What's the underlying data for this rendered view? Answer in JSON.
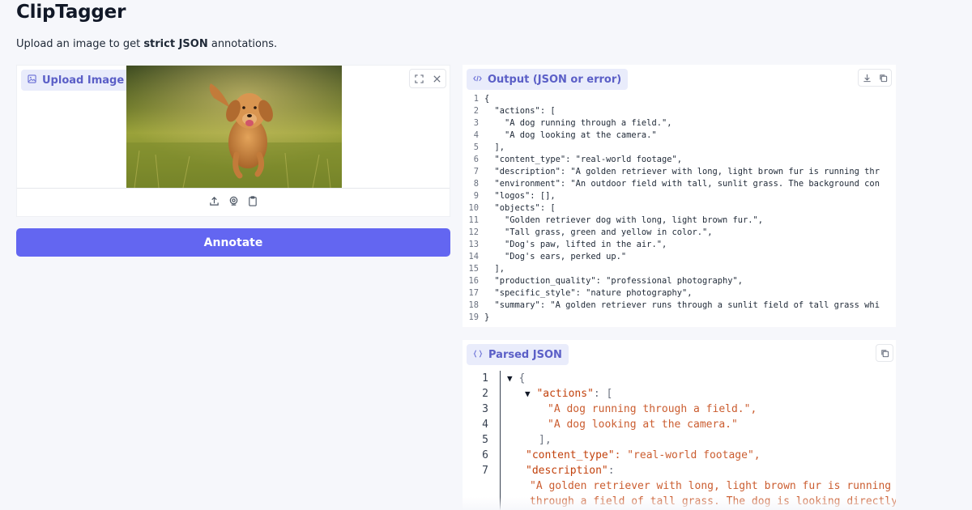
{
  "app": {
    "title": "ClipTagger",
    "subtitle_prefix": "Upload an image to get ",
    "subtitle_bold": "strict JSON",
    "subtitle_suffix": " annotations."
  },
  "upload": {
    "label": "Upload Image",
    "icon": "image-icon",
    "tools": [
      "fullscreen-icon",
      "close-icon"
    ],
    "actions": [
      "upload-icon",
      "webcam-icon",
      "clipboard-icon"
    ]
  },
  "annotate_button": "Annotate",
  "output": {
    "label": "Output (JSON or error)",
    "icon": "code-icon",
    "tools": [
      "download-icon",
      "copy-icon"
    ],
    "lines": [
      {
        "n": "1",
        "t": "{"
      },
      {
        "n": "2",
        "t": "  \"actions\": ["
      },
      {
        "n": "3",
        "t": "    \"A dog running through a field.\","
      },
      {
        "n": "4",
        "t": "    \"A dog looking at the camera.\""
      },
      {
        "n": "5",
        "t": "  ],"
      },
      {
        "n": "6",
        "t": "  \"content_type\": \"real-world footage\","
      },
      {
        "n": "7",
        "t": "  \"description\": \"A golden retriever with long, light brown fur is running thr"
      },
      {
        "n": "8",
        "t": "  \"environment\": \"An outdoor field with tall, sunlit grass. The background con"
      },
      {
        "n": "9",
        "t": "  \"logos\": [],"
      },
      {
        "n": "10",
        "t": "  \"objects\": ["
      },
      {
        "n": "11",
        "t": "    \"Golden retriever dog with long, light brown fur.\","
      },
      {
        "n": "12",
        "t": "    \"Tall grass, green and yellow in color.\","
      },
      {
        "n": "13",
        "t": "    \"Dog's paw, lifted in the air.\","
      },
      {
        "n": "14",
        "t": "    \"Dog's ears, perked up.\""
      },
      {
        "n": "15",
        "t": "  ],"
      },
      {
        "n": "16",
        "t": "  \"production_quality\": \"professional photography\","
      },
      {
        "n": "17",
        "t": "  \"specific_style\": \"nature photography\","
      },
      {
        "n": "18",
        "t": "  \"summary\": \"A golden retriever runs through a sunlit field of tall grass whi"
      },
      {
        "n": "19",
        "t": "}"
      }
    ]
  },
  "parsed": {
    "label": "Parsed JSON",
    "icon": "braces-icon",
    "tools": [
      "copy-icon"
    ],
    "line_numbers": [
      "1",
      "2",
      "3",
      "4",
      "5",
      "6",
      "7"
    ],
    "root_open": "{",
    "actions_key": "\"actions\"",
    "actions_open": ": [",
    "actions_items": [
      "\"A dog running through a field.\",",
      "\"A dog looking at the camera.\""
    ],
    "actions_close": "],",
    "content_type_key": "\"content_type\"",
    "content_type_val": ": \"real-world footage\",",
    "description_key": "\"description\"",
    "description_colon": ":",
    "description_val_1": "\"A golden retriever with long, light brown fur is running",
    "description_val_2": "through a field of tall grass. The dog is looking directly"
  },
  "colors": {
    "accent": "#6366f1",
    "label_bg": "#e9ecfb",
    "label_text": "#5b5fc7",
    "json_key": "#c2410c"
  }
}
